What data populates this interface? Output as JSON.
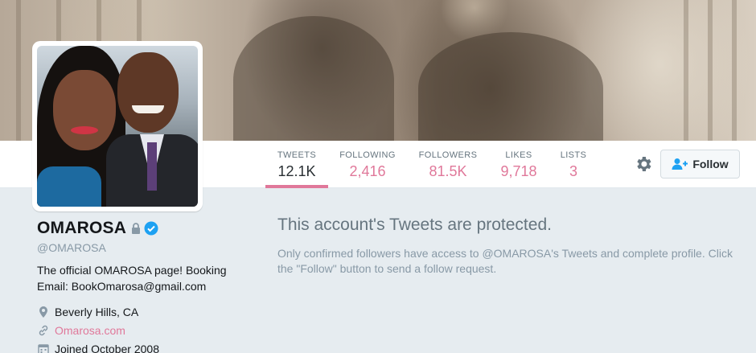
{
  "profile": {
    "name": "OMAROSA",
    "handle": "@OMAROSA",
    "bio": "The official OMAROSA page! Booking Email: BookOmarosa@gmail.com",
    "location": "Beverly Hills, CA",
    "website": "Omarosa.com",
    "joined": "Joined October 2008"
  },
  "nav": {
    "stats": [
      {
        "label": "TWEETS",
        "value": "12.1K"
      },
      {
        "label": "FOLLOWING",
        "value": "2,416"
      },
      {
        "label": "FOLLOWERS",
        "value": "81.5K"
      },
      {
        "label": "LIKES",
        "value": "9,718"
      },
      {
        "label": "LISTS",
        "value": "3"
      }
    ],
    "follow_label": "Follow"
  },
  "protected": {
    "title": "This account's Tweets are protected.",
    "message": "Only confirmed followers have access to @OMAROSA's Tweets and complete profile. Click the \"Follow\" button to send a follow request."
  },
  "colors": {
    "accent": "#e0789a",
    "verified": "#1da1f2",
    "background": "#e6ecf0"
  },
  "icons": [
    "lock-icon",
    "verified-badge-icon",
    "location-pin-icon",
    "link-icon",
    "calendar-icon",
    "gear-icon",
    "follow-user-icon"
  ]
}
